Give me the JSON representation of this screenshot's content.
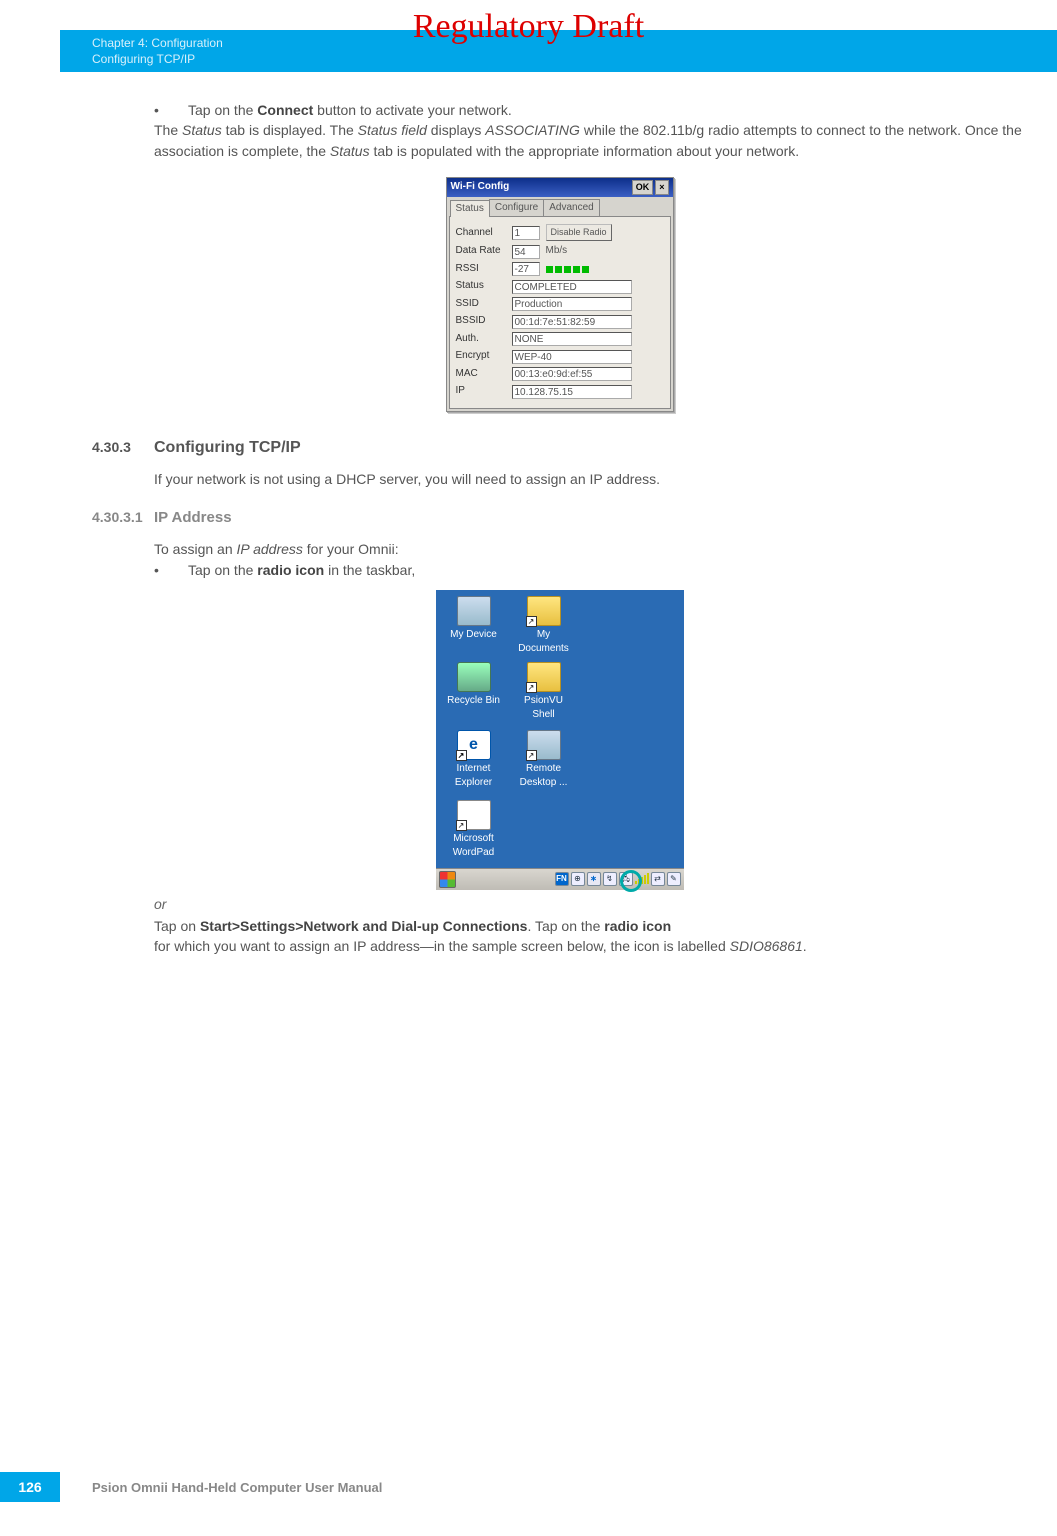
{
  "watermark": "Regulatory Draft",
  "header": {
    "line1": "Chapter 4:  Configuration",
    "line2": "Configuring TCP/IP"
  },
  "body": {
    "bullet1a": "Tap on the ",
    "bullet1b": "Connect",
    "bullet1c": " button to activate your network.",
    "p1a": "The ",
    "p1b": "Status",
    "p1c": " tab is displayed. The ",
    "p1d": "Status field",
    "p1e": " displays ",
    "p1f": "ASSOCIATING",
    "p1g": " while the 802.11b/g radio attempts to connect to the network. Once the association is complete, the ",
    "p1h": "Status",
    "p1i": " tab is populated with the appropriate information about your network."
  },
  "wifi": {
    "title": "Wi-Fi Config",
    "ok": "OK",
    "tabs": [
      "Status",
      "Configure",
      "Advanced"
    ],
    "rows": {
      "Channel": "1",
      "DataRateLabel": "Data Rate",
      "DataRate": "54",
      "DataRateUnit": "Mb/s",
      "RSSI": "-27",
      "Status": "COMPLETED",
      "SSID": "Production",
      "BSSID": "00:1d:7e:51:82:59",
      "Auth": "NONE",
      "AuthLabel": "Auth.",
      "Encrypt": "WEP-40",
      "MAC": "00:13:e0:9d:ef:55",
      "IP": "10.128.75.15"
    },
    "disable": "Disable Radio"
  },
  "sec4303": {
    "num": "4.30.3",
    "title": "Configuring TCP/IP",
    "p": "If your network is not using a DHCP server, you will need to assign an IP address."
  },
  "sec43031": {
    "num": "4.30.3.1",
    "title": "IP Address",
    "p1a": "To assign an ",
    "p1b": "IP address",
    "p1c": " for your Omnii:",
    "b1a": "Tap on the ",
    "b1b": "radio icon",
    "b1c": " in the taskbar,"
  },
  "desktop": {
    "icons": {
      "mydevice": "My Device",
      "mydocs": "My\nDocuments",
      "recycle": "Recycle Bin",
      "psion": "PsionVU\nShell",
      "ie": "Internet\nExplorer",
      "remote": "Remote\nDesktop ...",
      "wordpad": "Microsoft\nWordPad"
    }
  },
  "or_line": "or",
  "p2a": "Tap on ",
  "p2b": "Start>Settings>Network and Dial-up Connections",
  "p2c": ". Tap on the ",
  "p2d": "radio icon",
  "p2e": " for which you want to assign an IP address—in the sample screen below, the icon is labelled ",
  "p2f": "SDIO86861",
  "p2g": ".",
  "footer": {
    "page": "126",
    "text": "Psion Omnii Hand-Held Computer User Manual"
  }
}
